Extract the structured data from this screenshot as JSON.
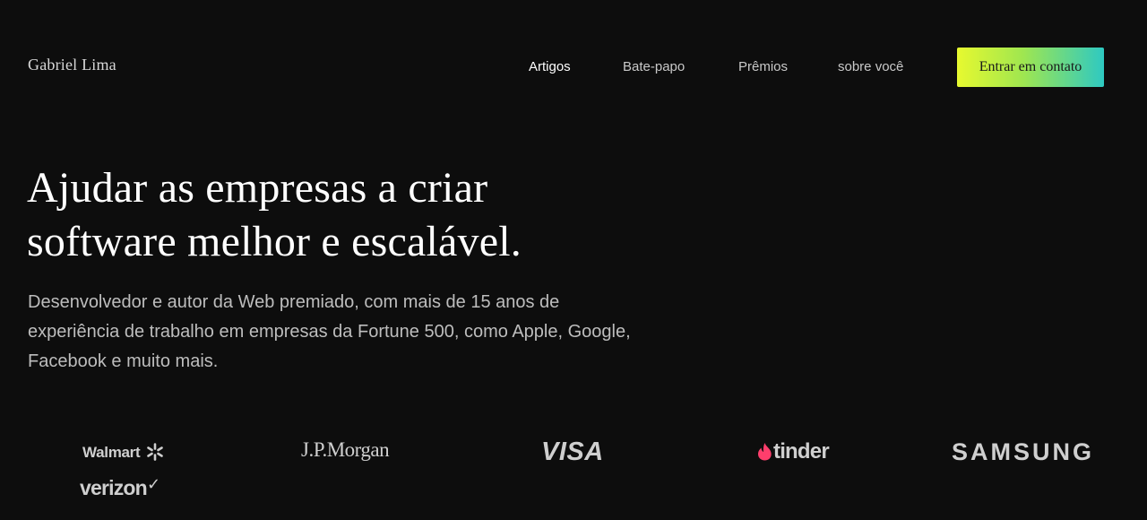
{
  "header": {
    "brand": "Gabriel Lima",
    "nav": [
      {
        "label": "Artigos",
        "active": true
      },
      {
        "label": "Bate-papo",
        "active": false
      },
      {
        "label": "Prêmios",
        "active": false
      },
      {
        "label": "sobre você",
        "active": false
      }
    ],
    "cta_label": "Entrar em contato"
  },
  "hero": {
    "title_line1": "Ajudar as empresas a criar",
    "title_line2": "software melhor e escalável.",
    "subtitle": "Desenvolvedor e autor da Web premiado, com mais de 15 anos de experiência de trabalho em empresas da Fortune 500, como Apple, Google, Facebook e muito mais."
  },
  "logos": {
    "walmart": "Walmart",
    "jpmorgan": "J.P.Morgan",
    "visa": "VISA",
    "tinder": "tinder",
    "samsung": "SAMSUNG",
    "verizon": "verizon"
  },
  "colors": {
    "background": "#0d0d0d",
    "cta_gradient_start": "#e7f92f",
    "cta_gradient_end": "#2ec9c2",
    "tinder_flame": "#ff3e6c"
  }
}
